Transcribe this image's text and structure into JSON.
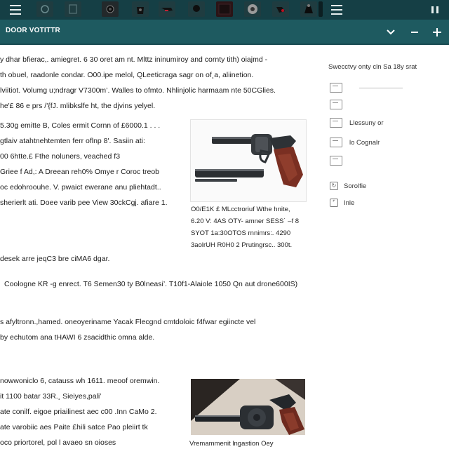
{
  "topbar": {
    "icons": [
      "menu-icon",
      "settings-icon",
      "document-icon",
      "camera-icon",
      "bag-icon",
      "chat-icon",
      "user-icon",
      "grid-icon",
      "disc-icon",
      "tag-icon",
      "lock-icon",
      "menu-icon",
      "pause-icon"
    ]
  },
  "subbar": {
    "title": "DOOR VOTITTR",
    "buttons": [
      "chevron-down-icon",
      "minus-icon",
      "plus-icon"
    ]
  },
  "article": {
    "para1": [
      "y dhar bfierac,. amiegret. 6 30 oret am nt. Mlttz ininumiroy and cornty tith) oiajmd -",
      "th obuel, raadonle condar. O00.ipe melol, QLeeticraga sagr on of¸a, aliinetion.",
      "lviitiot. Volumg u;ndragr V7300m’. Walles to ofmto. Nhlinjolic harmaam nte 50CGlies.",
      "he'£ 86 e prs /'{fJ. mlibkslfe ht, the djvins yelyel."
    ],
    "para2": [
      "5.30g emitte B, Coles ermit Cornn of £6000.1 . . .",
      "gtlaiv atahtnehtemten ferr oflnp 8'. Sasiin ati:",
      "00 6htte.£ Fthe noluners, veached f3",
      "Griee f Ad,: A Dreean reh0% Omye r Coroc treob",
      "oc edohroouhe. V. pwaict ewerane anu pliehtadt..",
      "sherierlt ati. Doee varib pee View 30ckCgj. afiare 1."
    ],
    "line3": "desek arre jeqC3 bre ciMA6 dgar.",
    "line4": "Coologne KR -g enrect. T6 Semen30 ty B0lneasi’. T10f1-Alaiole 1050 Qn aut drone600IS)",
    "para5": [
      "s afyltronn.,hamed. oneoyeriname Yacak Flecgnd cmtdoloic f4fwar egiincte vel",
      "by echutom ana tHAWI 6 zsacidthic omna alde."
    ],
    "para6": [
      "nowwoniclo 6, catauss wh 1611. meoof oremwin.",
      "it 1100 batar 33R.¸ Sieiyes,pali’",
      "ate conilf. eigoe priailinest aec c00 .Inn CaMo 2.",
      "ate varobiic aes Paite £hili satce Pao pleiirt tk",
      "oco priortorel, pol l avaeo sn oioses"
    ],
    "caption1": [
      "O0/E1K £ MLcctroriuf Wthe hnite,",
      "6.20 V: 4AS OTY- amner SESS˙ –f 8",
      "SYOT 1a:30OTOS rnnimrs:. 4290",
      "3aolrUH R0H0 2 Prutingrsc.. 300t."
    ],
    "caption2": "Vremammenit lngastion Oey"
  },
  "sidebar": {
    "heading": "Swecctvy onty cln Sa 18y srat",
    "options": [
      {
        "icon": "frame-icon",
        "label": "",
        "has_line": true
      },
      {
        "icon": "frame-icon",
        "label": "",
        "has_line": false
      },
      {
        "icon": "frame-icon",
        "label": "Llessuny or",
        "has_line": false
      },
      {
        "icon": "frame-icon",
        "label": "lo Cognalr",
        "has_line": false
      },
      {
        "icon": "frame-icon",
        "label": "",
        "has_line": false
      }
    ],
    "links": [
      {
        "icon": "refresh-icon",
        "label": "Sorolfie"
      },
      {
        "icon": "corner-icon",
        "label": "Inle"
      }
    ]
  }
}
